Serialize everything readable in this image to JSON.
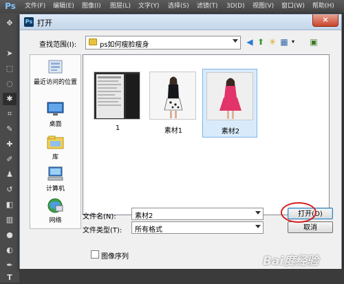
{
  "menubar": {
    "app_logo": "Ps",
    "items": [
      "文件(F)",
      "编辑(E)",
      "图像(I)",
      "图层(L)",
      "文字(Y)",
      "选择(S)",
      "滤镜(T)",
      "3D(D)",
      "视图(V)",
      "窗口(W)",
      "帮助(H)"
    ]
  },
  "dialog": {
    "title_icon": "Ps",
    "title": "打开",
    "close_symbol": "×",
    "look_in_label": "查找范围(I):",
    "look_in_value": "ps如何瘦脸瘦身",
    "places": [
      {
        "label": "最近访问的位置",
        "icon": "recent-places-icon"
      },
      {
        "label": "桌面",
        "icon": "desktop-icon"
      },
      {
        "label": "库",
        "icon": "libraries-icon"
      },
      {
        "label": "计算机",
        "icon": "computer-icon"
      },
      {
        "label": "网络",
        "icon": "network-icon"
      }
    ],
    "files": [
      {
        "name": "1",
        "selected": false
      },
      {
        "name": "素材1",
        "selected": false
      },
      {
        "name": "素材2",
        "selected": true
      }
    ],
    "filename_label": "文件名(N):",
    "filename_value": "素材2",
    "filetype_label": "文件类型(T):",
    "filetype_value": "所有格式",
    "open_button": "打开(O)",
    "cancel_button": "取消",
    "image_sequence_label": "图像序列"
  },
  "watermark": "Bai度经验",
  "colors": {
    "selection": "#d9ebfb",
    "annotation_ring": "#d81e1e",
    "dress_pink": "#e2346a"
  }
}
